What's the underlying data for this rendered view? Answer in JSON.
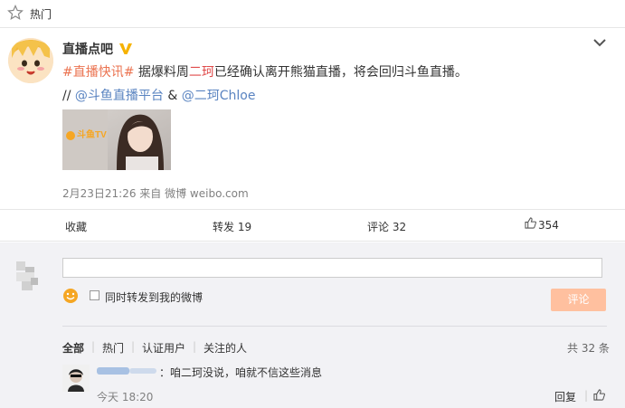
{
  "topbar": {
    "label": "热门"
  },
  "post": {
    "author": "直播点吧",
    "content": {
      "hashtag": "#直播快讯#",
      "part1": " 据爆料周",
      "highlight": "二珂",
      "part2": "已经确认离开熊猫直播，将会回归斗鱼直播。"
    },
    "mentions": {
      "prefix": "// ",
      "m1": "@斗鱼直播平台",
      "amp": " & ",
      "m2": "@二珂Chloe"
    },
    "meta": "2月23日21:26 来自 微博 weibo.com",
    "thumbnail_text": "斗鱼TV"
  },
  "actions": {
    "favorite": "收藏",
    "repost": "转发 19",
    "comment": "评论 32",
    "like": "354"
  },
  "composer": {
    "placeholder": "",
    "forward_label": "同时转发到我的微博",
    "submit": "评论"
  },
  "filters": {
    "all": "全部",
    "hot": "热门",
    "verified": "认证用户",
    "following": "关注的人",
    "total": "共 32 条"
  },
  "comment": {
    "text": "：咱二珂没说，咱就不信这些消息",
    "time": "今天 18:20",
    "reply": "回复"
  },
  "colors": {
    "link": "#eb7350",
    "mention": "#5a84c1",
    "submit_bg": "#ffc09f",
    "panel_bg": "#f2f2f5"
  }
}
